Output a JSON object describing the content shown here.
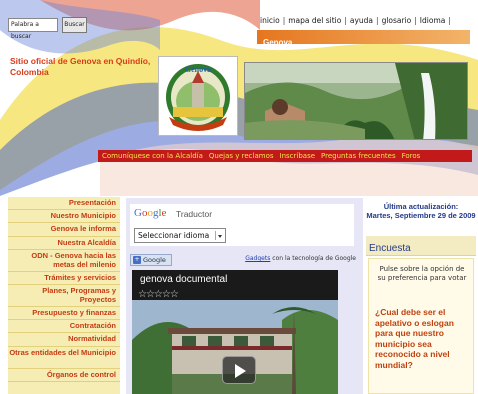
{
  "search": {
    "placeholder": "Palabra a buscar",
    "button": "Buscar"
  },
  "topnav": [
    "inicio",
    "mapa del sitio",
    "ayuda",
    "glosario",
    "Idioma"
  ],
  "section_title": "Genova",
  "site_title": "Sitio oficial de Genova en Quindío, Colombia",
  "logo_text": "Génova",
  "red_nav": [
    "Comuníquese con la Alcaldía",
    "Quejas y reclamos",
    "Inscríbase",
    "Preguntas frecuentes",
    "Foros"
  ],
  "sidebar": [
    "Presentación",
    "Nuestro Municipio",
    "Genova le informa",
    "Nuestra Alcaldía",
    "ODN - Genova hacia las metas del milenio",
    "Trámites y servicios",
    "Planes, Programas y Proyectos",
    "Presupuesto y finanzas",
    "Contratación",
    "Normatividad",
    "Otras entidades del Municipio",
    "Órganos de control"
  ],
  "translator": {
    "google": "Google",
    "word": "Traductor",
    "select": "Seleccionar idioma"
  },
  "gadget": {
    "badge": "Google",
    "link": "Gadgets",
    "text": "con la tecnología de Google"
  },
  "video": {
    "title": "genova documental",
    "stars": "☆☆☆☆☆"
  },
  "update": {
    "label": "Última actualización:",
    "date": "Martes, Septiembre 29 de 2009"
  },
  "encuesta": {
    "title": "Encuesta",
    "intro": "Pulse sobre la opción de su preferencia para votar",
    "question": "¿Cual debe ser el apelativo o eslogan para que nuestro municipio sea reconocido a nivel mundial?"
  },
  "colors": {
    "accent_red": "#c21a1a",
    "link_orange": "#c43c12",
    "nav_yellow": "#f0e44a",
    "sidebar_bg": "#f6edb4"
  }
}
